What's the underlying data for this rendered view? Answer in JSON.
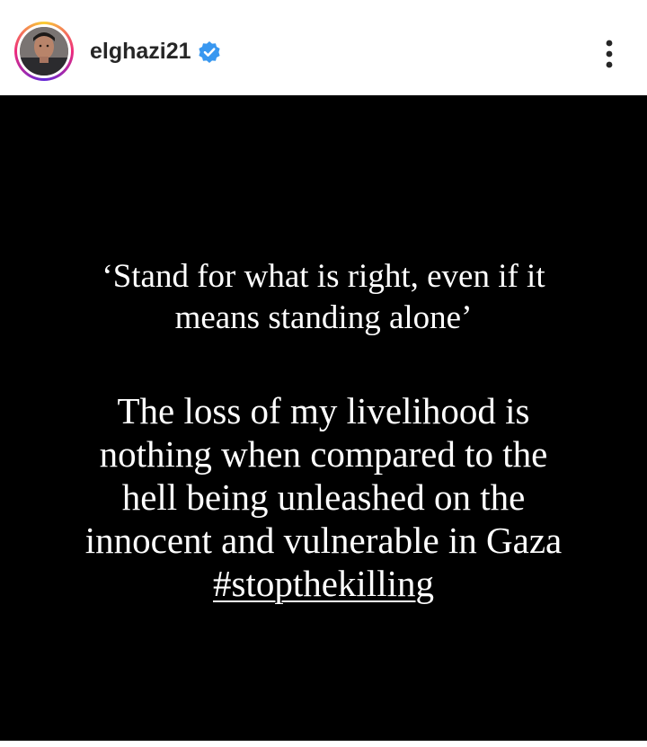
{
  "header": {
    "username": "elghazi21",
    "verified_icon": "verified-badge-icon",
    "more_icon": "more-vertical-icon",
    "colors": {
      "verified": "#3897f0",
      "text": "#262626"
    }
  },
  "story": {
    "background_color": "#000000",
    "text_color": "#ffffff",
    "quote_lines": [
      "‘Stand for what is right, even if it",
      "means standing alone’"
    ],
    "message_lines": [
      "The loss of my livelihood is",
      "nothing when compared to the",
      "hell being unleashed on the",
      "innocent and vulnerable in Gaza"
    ],
    "hashtag": "#stopthekilling"
  }
}
